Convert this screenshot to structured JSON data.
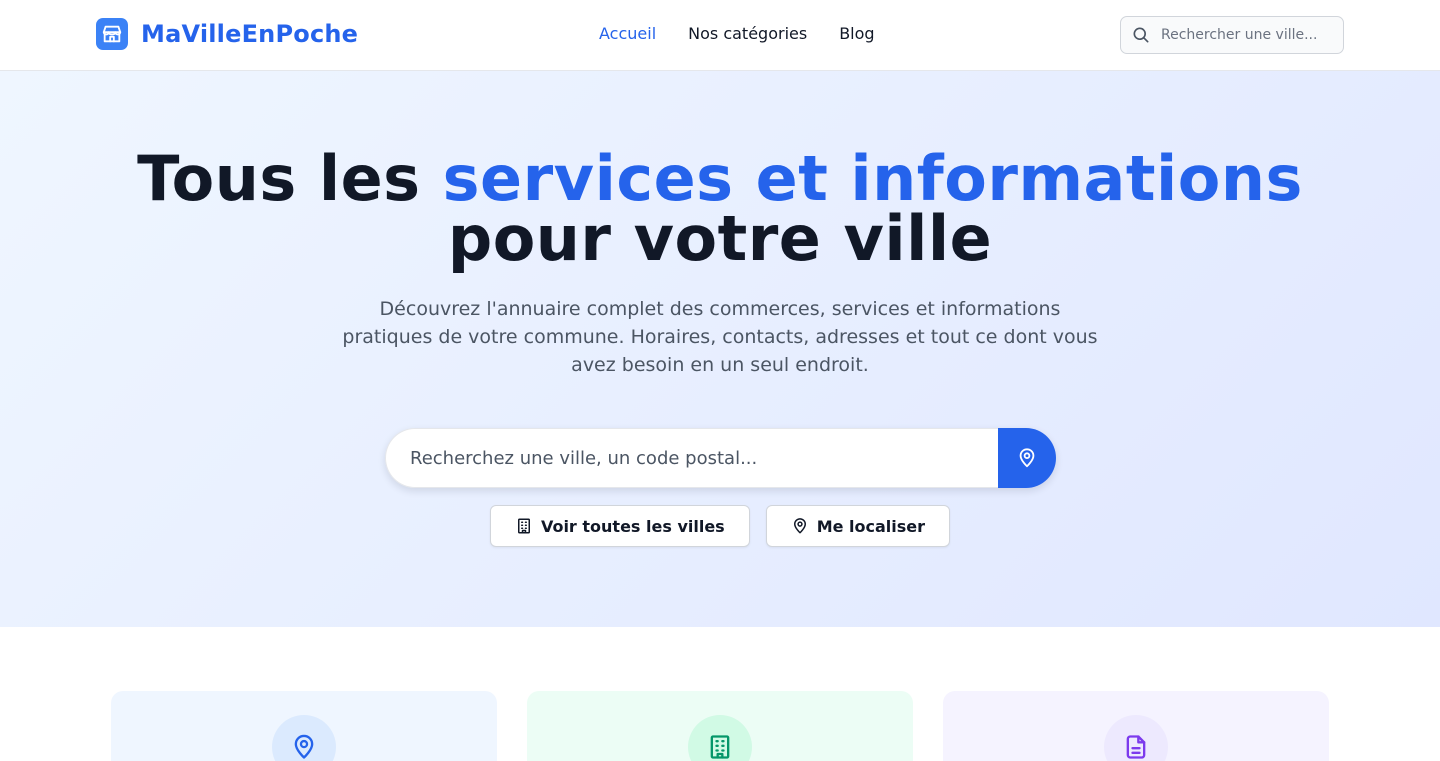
{
  "header": {
    "brand": "MaVilleEnPoche",
    "nav": [
      {
        "label": "Accueil",
        "active": true
      },
      {
        "label": "Nos catégories",
        "active": false
      },
      {
        "label": "Blog",
        "active": false
      }
    ],
    "search_placeholder": "Rechercher une ville..."
  },
  "hero": {
    "title_part1": "Tous les ",
    "title_accent": "services et informations",
    "title_part2": "pour votre ville",
    "subtitle": "Découvrez l'annuaire complet des commerces, services et informations pratiques de votre commune. Horaires, contacts, adresses et tout ce dont vous avez besoin en un seul endroit.",
    "search_placeholder": "Recherchez une ville, un code postal...",
    "buttons": {
      "all_cities": "Voir toutes les villes",
      "locate": "Me localiser"
    }
  },
  "cards": [
    {
      "icon": "map-pin-icon",
      "color": "#2563eb"
    },
    {
      "icon": "building-icon",
      "color": "#059669"
    },
    {
      "icon": "document-icon",
      "color": "#7c3aed"
    }
  ],
  "colors": {
    "accent": "#2563eb",
    "text": "#111827",
    "muted": "#4b5563"
  }
}
